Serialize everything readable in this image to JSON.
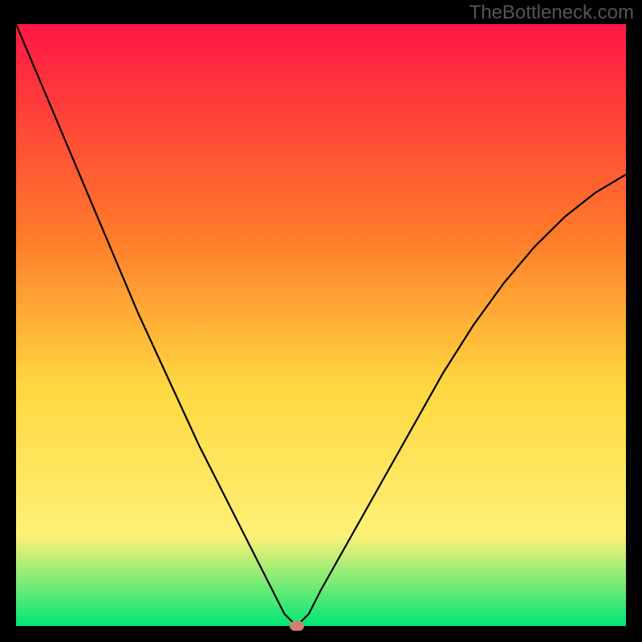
{
  "watermark": "TheBottleneck.com",
  "chart_data": {
    "type": "line",
    "title": "",
    "xlabel": "",
    "ylabel": "",
    "xlim": [
      0,
      100
    ],
    "ylim": [
      0,
      100
    ],
    "gradient_colors": {
      "top": "#ff1744",
      "mid_upper": "#ff7a2a",
      "mid": "#ffd740",
      "mid_lower": "#fff176",
      "bottom": "#00e676"
    },
    "series": [
      {
        "name": "curve",
        "x": [
          0,
          5,
          10,
          15,
          20,
          25,
          30,
          35,
          40,
          42,
          44,
          46,
          48,
          50,
          55,
          60,
          65,
          70,
          75,
          80,
          85,
          90,
          95,
          100
        ],
        "y": [
          100,
          88,
          76,
          64,
          52,
          41,
          30,
          20,
          10,
          6,
          2,
          0,
          2,
          6,
          15,
          24,
          33,
          42,
          50,
          57,
          63,
          68,
          72,
          75
        ]
      }
    ],
    "marker": {
      "x": 46,
      "y": 0
    }
  }
}
